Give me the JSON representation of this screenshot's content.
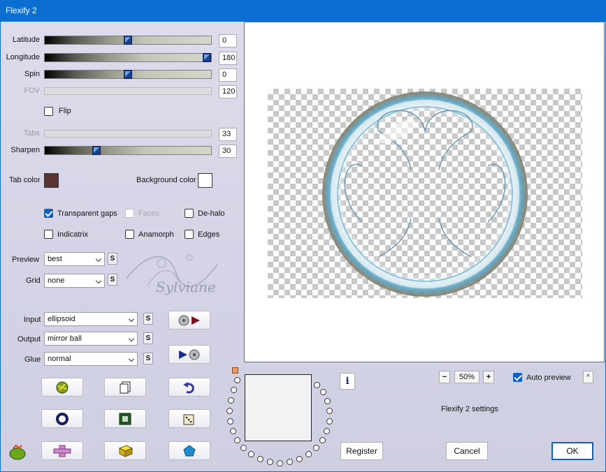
{
  "window": {
    "title": "Flexify 2"
  },
  "sliders": [
    {
      "label": "Latitude",
      "value": "0",
      "level": 0.5,
      "enabled": true
    },
    {
      "label": "Longitude",
      "value": "180",
      "level": 1.0,
      "enabled": true
    },
    {
      "label": "Spin",
      "value": "0",
      "level": 0.5,
      "enabled": true
    },
    {
      "label": "FOV",
      "value": "120",
      "level": null,
      "enabled": false
    },
    {
      "label": "Tabs",
      "value": "33",
      "level": null,
      "enabled": false
    },
    {
      "label": "Sharpen",
      "value": "30",
      "level": 0.3,
      "enabled": true
    }
  ],
  "flip": {
    "label": "Flip",
    "checked": false
  },
  "colors": {
    "tab_color_label": "Tab color",
    "tab_color": "#5a3434",
    "background_color_label": "Background color",
    "background_color": "#ffffff",
    "accent": "#0a64c8",
    "title_bar": "#0a6fd0"
  },
  "options": {
    "transparent_gaps": {
      "label": "Transparent gaps",
      "checked": true
    },
    "faces": {
      "label": "Faces",
      "checked": false,
      "enabled": false
    },
    "de_halo": {
      "label": "De-halo",
      "checked": false
    },
    "indicatrix": {
      "label": "Indicatrix",
      "checked": false
    },
    "anamorph": {
      "label": "Anamorph",
      "checked": false
    },
    "edges": {
      "label": "Edges",
      "checked": false
    }
  },
  "preview_select": {
    "label": "Preview",
    "value": "best"
  },
  "grid_select": {
    "label": "Grid",
    "value": "none"
  },
  "input_select": {
    "label": "Input",
    "value": "ellipsoid"
  },
  "output_select": {
    "label": "Output",
    "value": "mirror ball"
  },
  "glue_select": {
    "label": "Glue",
    "value": "normal"
  },
  "small_button": "S",
  "watermark": "Sylviane",
  "zoom": {
    "minus": "−",
    "value": "50%",
    "plus": "+"
  },
  "auto_preview": {
    "label": "Auto preview",
    "checked": true
  },
  "collapse_button": "^",
  "settings_label": "Flexify 2 settings",
  "info_button": "i",
  "buttons": {
    "register": "Register",
    "cancel": "Cancel",
    "ok": "OK"
  },
  "icons": {
    "import_preset": "disc-arrow-left-icon",
    "export_preset": "disc-arrow-right-icon",
    "randomize": "globe-icon",
    "copy": "copy-icon",
    "undo": "undo-icon",
    "ring": "ring-icon",
    "frame": "frame-icon",
    "dice": "dice-icon",
    "plugin_logo": "cactus-logo-icon",
    "cross_shape": "cross-shape-icon",
    "cube_shape": "cube-shape-icon",
    "pentagon_shape": "pentagon-shape-icon"
  }
}
